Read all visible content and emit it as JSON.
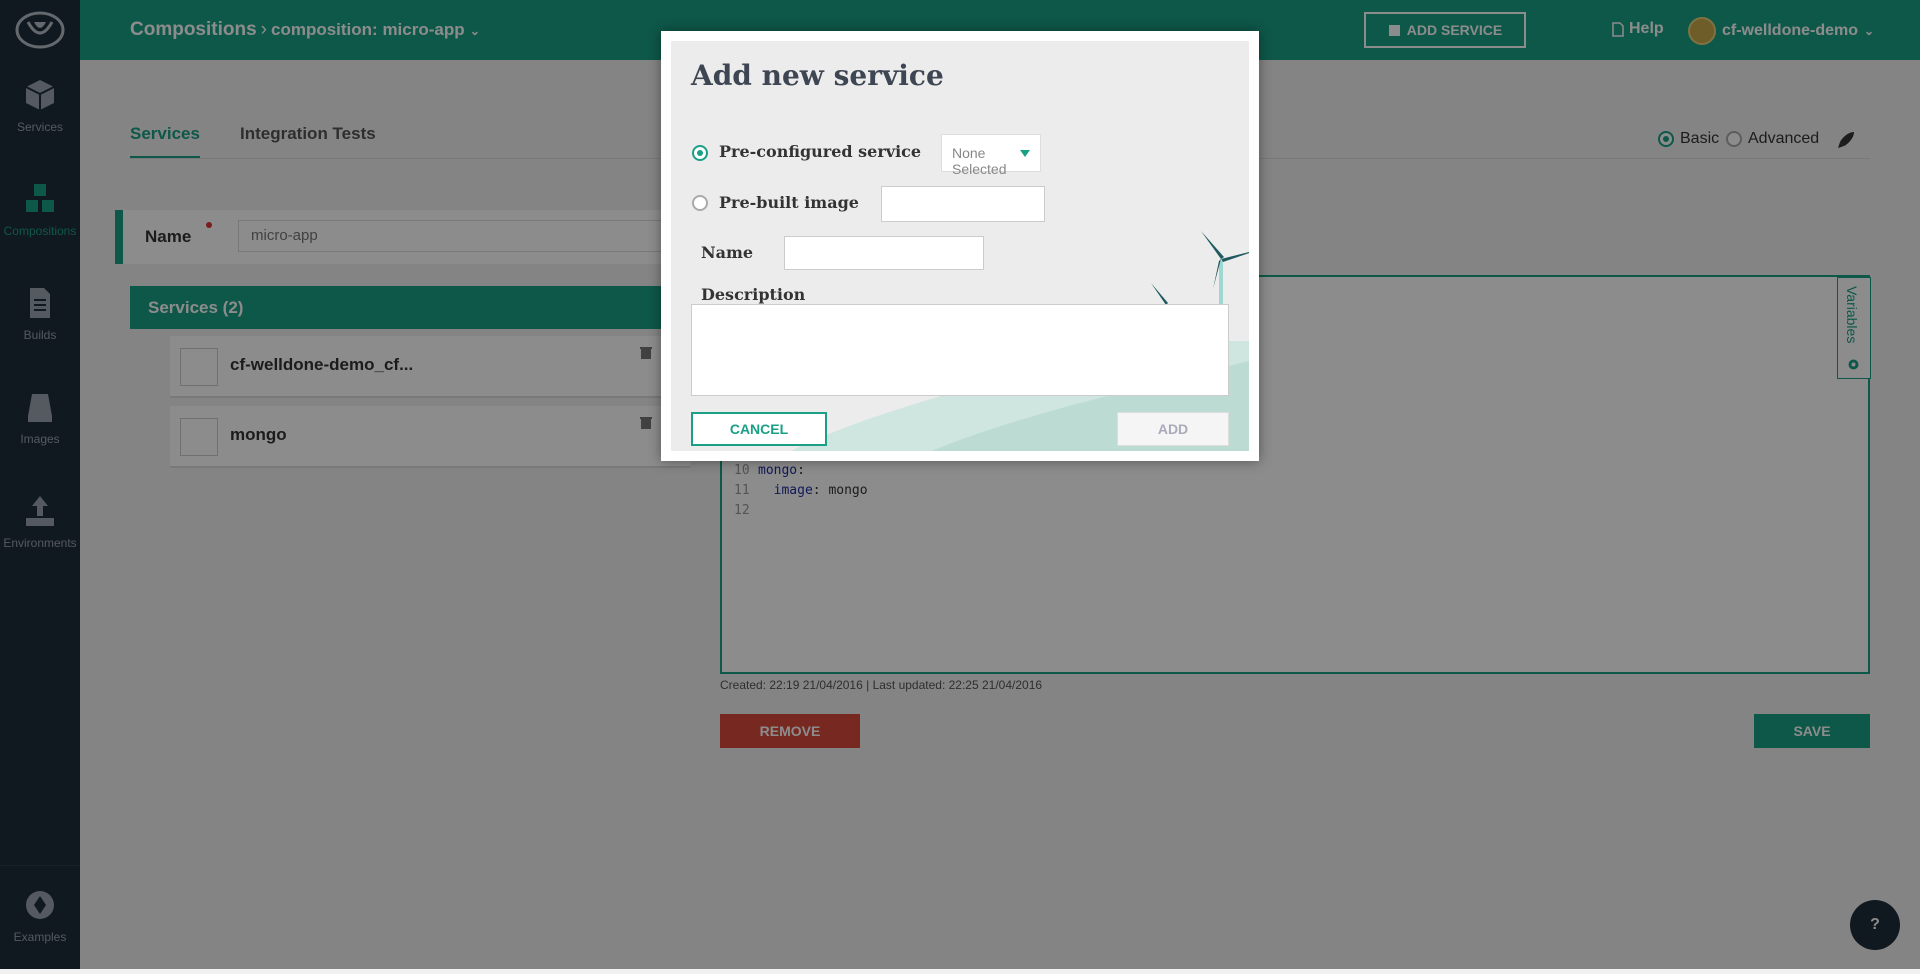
{
  "sidebar": {
    "items": [
      {
        "label": "Services",
        "icon": "box-icon"
      },
      {
        "label": "Compositions",
        "icon": "cubes-icon"
      },
      {
        "label": "Builds",
        "icon": "document-icon"
      },
      {
        "label": "Images",
        "icon": "disk-icon"
      },
      {
        "label": "Environments",
        "icon": "upload-icon"
      }
    ],
    "bottom": {
      "label": "Examples",
      "icon": "examples-icon"
    }
  },
  "header": {
    "crumb_root": "Compositions",
    "crumb_sep": "›",
    "crumb_current": "composition:  micro-app",
    "add_service": "ADD SERVICE",
    "help": "Help",
    "user": "cf-welldone-demo"
  },
  "tabs": [
    "Services",
    "Integration Tests"
  ],
  "mode": {
    "basic": "Basic",
    "advanced": "Advanced"
  },
  "name_field": {
    "label": "Name",
    "value": "micro-app"
  },
  "services": {
    "header": "Services (2)",
    "items": [
      "cf-welldone-demo_cf...",
      "mongo"
    ]
  },
  "editor": {
    "lines": [
      {
        "num": "10",
        "indent": "",
        "key": "mongo",
        "rest": ":"
      },
      {
        "num": "11",
        "indent": "  ",
        "key": "image",
        "rest": ": mongo"
      },
      {
        "num": "12",
        "indent": "",
        "key": "",
        "rest": ""
      }
    ],
    "variables_tab": "Variables"
  },
  "meta": "Created: 22:19 21/04/2016 | Last updated: 22:25 21/04/2016",
  "buttons": {
    "remove": "REMOVE",
    "save": "SAVE"
  },
  "chat": "?",
  "modal": {
    "title": "Add new service",
    "preconfigured_label": "Pre-configured service",
    "dropdown_value": "None Selected",
    "prebuilt_label": "Pre-built image",
    "name_label": "Name",
    "description_label": "Description",
    "cancel": "CANCEL",
    "add": "ADD"
  },
  "colors": {
    "accent": "#1aa086",
    "sidebar": "#1e2d3b",
    "danger": "#d94a3d"
  }
}
